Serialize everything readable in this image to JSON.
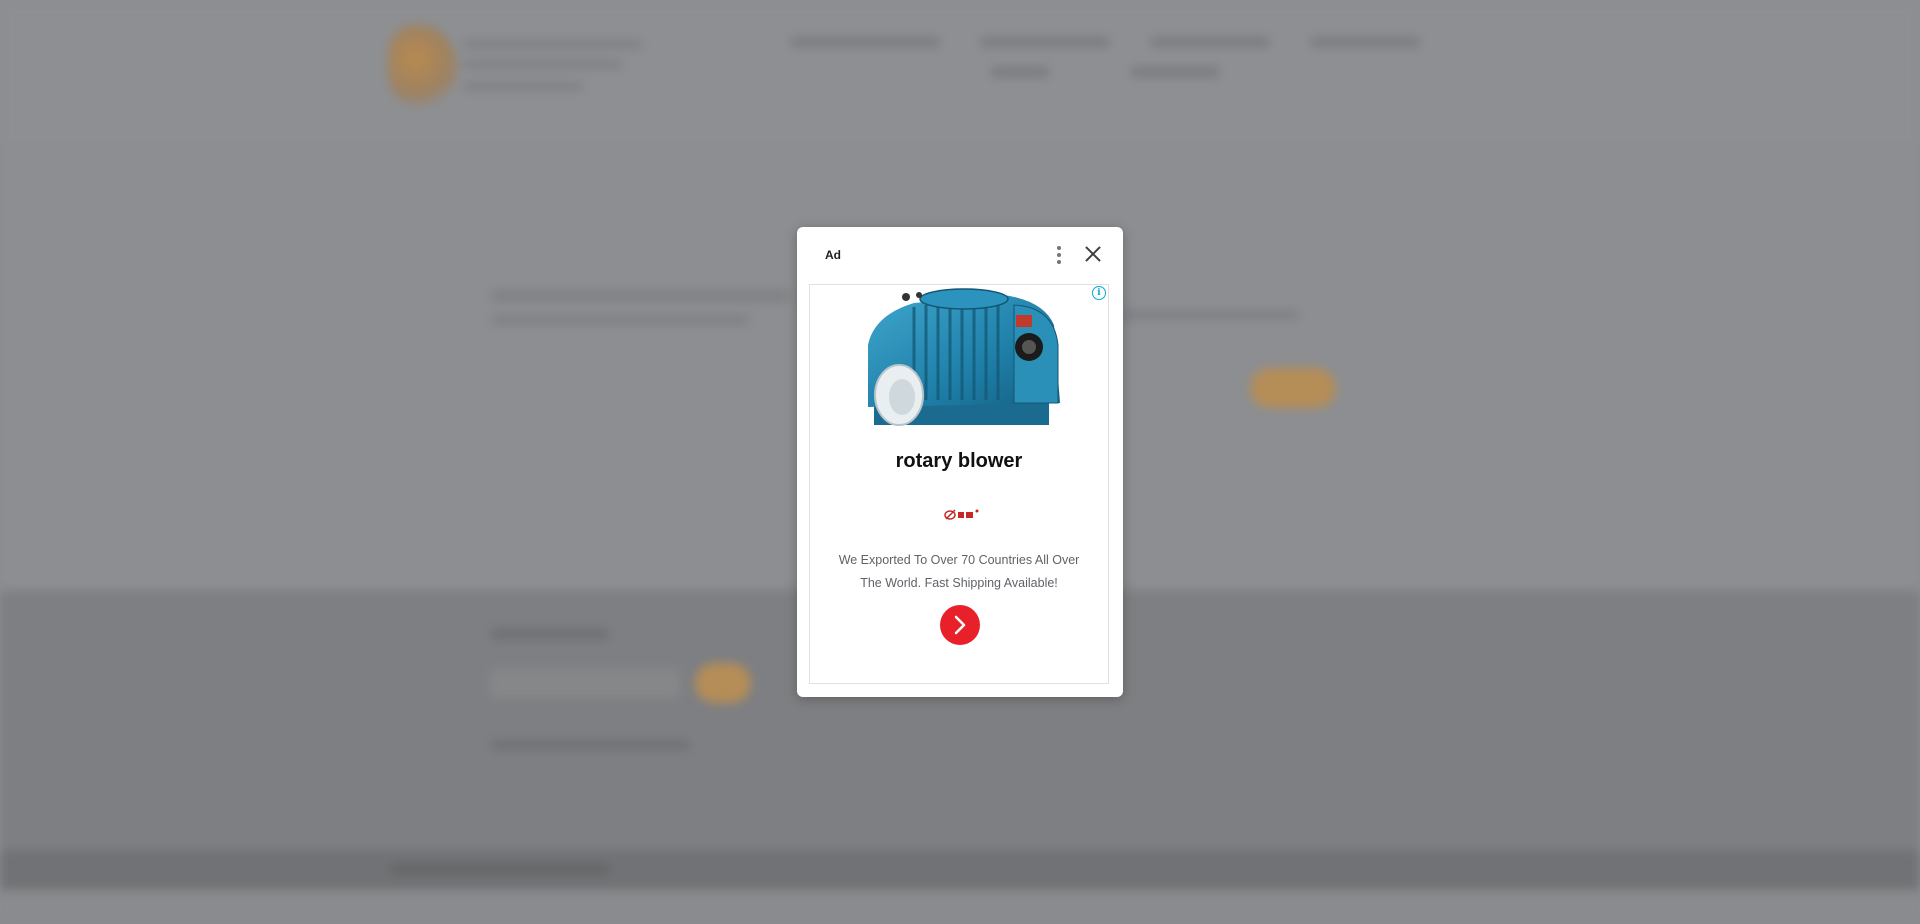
{
  "ad": {
    "label": "Ad",
    "title": "rotary blower",
    "description": "We Exported To Over 70 Countries All Over The World. Fast Shipping Available!",
    "info_icon": "info-icon",
    "menu_icon": "more-vert-icon",
    "close_icon": "close-icon",
    "cta_icon": "chevron-right-icon",
    "cta_color": "#e8202a",
    "product_color": "#2a8ab0"
  }
}
